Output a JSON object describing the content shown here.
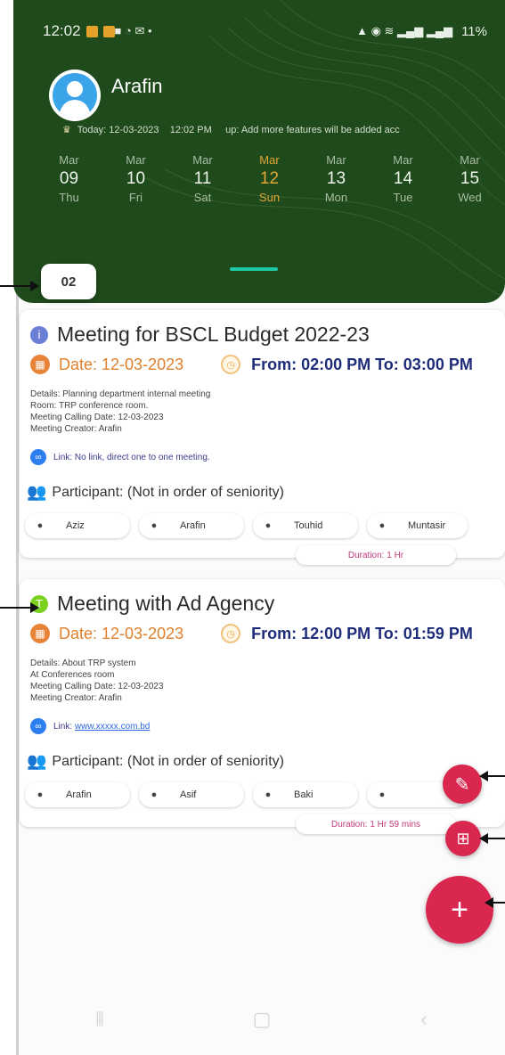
{
  "status_bar": {
    "time": "12:02",
    "battery": "11%"
  },
  "header": {
    "username": "Arafin",
    "today_label": "Today: 12-03-2023",
    "today_time": "12:02 PM",
    "notice": "up: Add more features will be added acc"
  },
  "calendar": {
    "days": [
      {
        "month": "Mar",
        "date": "09",
        "weekday": "Thu",
        "active": false
      },
      {
        "month": "Mar",
        "date": "10",
        "weekday": "Fri",
        "active": false
      },
      {
        "month": "Mar",
        "date": "11",
        "weekday": "Sat",
        "active": false
      },
      {
        "month": "Mar",
        "date": "12",
        "weekday": "Sun",
        "active": true
      },
      {
        "month": "Mar",
        "date": "13",
        "weekday": "Mon",
        "active": false
      },
      {
        "month": "Mar",
        "date": "14",
        "weekday": "Tue",
        "active": false
      },
      {
        "month": "Mar",
        "date": "15",
        "weekday": "Wed",
        "active": false
      }
    ]
  },
  "count_badge": "02",
  "meetings": [
    {
      "icon_letter": "i",
      "icon_color": "#6b7fd6",
      "title": "Meeting for BSCL Budget 2022-23",
      "date": "Date: 12-03-2023",
      "time": "From: 02:00 PM To: 03:00 PM",
      "details": "Details: Planning department internal meeting",
      "room": "Room: TRP conference room.",
      "calling_date": "Meeting Calling Date: 12-03-2023",
      "creator": "Meeting Creator: Arafin",
      "link_prefix": "Link:",
      "link_text": "No link, direct one to one meeting.",
      "participant_heading": "Participant: (Not in order of seniority)",
      "participants": [
        "Aziz",
        "Arafin",
        "Touhid",
        "Muntasir"
      ],
      "duration": "Duration: 1 Hr"
    },
    {
      "icon_letter": "T",
      "icon_color": "#7bd11f",
      "title": "Meeting with Ad Agency",
      "date": "Date: 12-03-2023",
      "time": "From: 12:00 PM To: 01:59 PM",
      "details": "Details: About TRP system",
      "room": "At Conferences room",
      "calling_date": "Meeting Calling Date: 12-03-2023",
      "creator": "Meeting Creator: Arafin",
      "link_prefix": "Link:",
      "link_text": "www.xxxxx.com.bd",
      "participant_heading": "Participant: (Not in order of seniority)",
      "participants": [
        "Arafin",
        "Asif",
        "Baki",
        ""
      ],
      "duration": "Duration: 1 Hr 59 mins"
    }
  ],
  "fab": {
    "add": "+"
  },
  "colors": {
    "header_bg": "#1f4a1b",
    "accent": "#e3a534",
    "indicator": "#20c9a6",
    "fab": "#d9274f",
    "time_text": "#1e2c7a",
    "date_text": "#e0802c"
  },
  "icons": [
    "signal-icon",
    "wifi-icon",
    "battery-icon",
    "trophy-icon",
    "calendar-icon",
    "clock-icon",
    "link-icon",
    "group-icon",
    "person-icon",
    "note-icon",
    "grid-icon",
    "plus-icon",
    "nav-recents-icon",
    "nav-home-icon",
    "nav-back-icon"
  ]
}
